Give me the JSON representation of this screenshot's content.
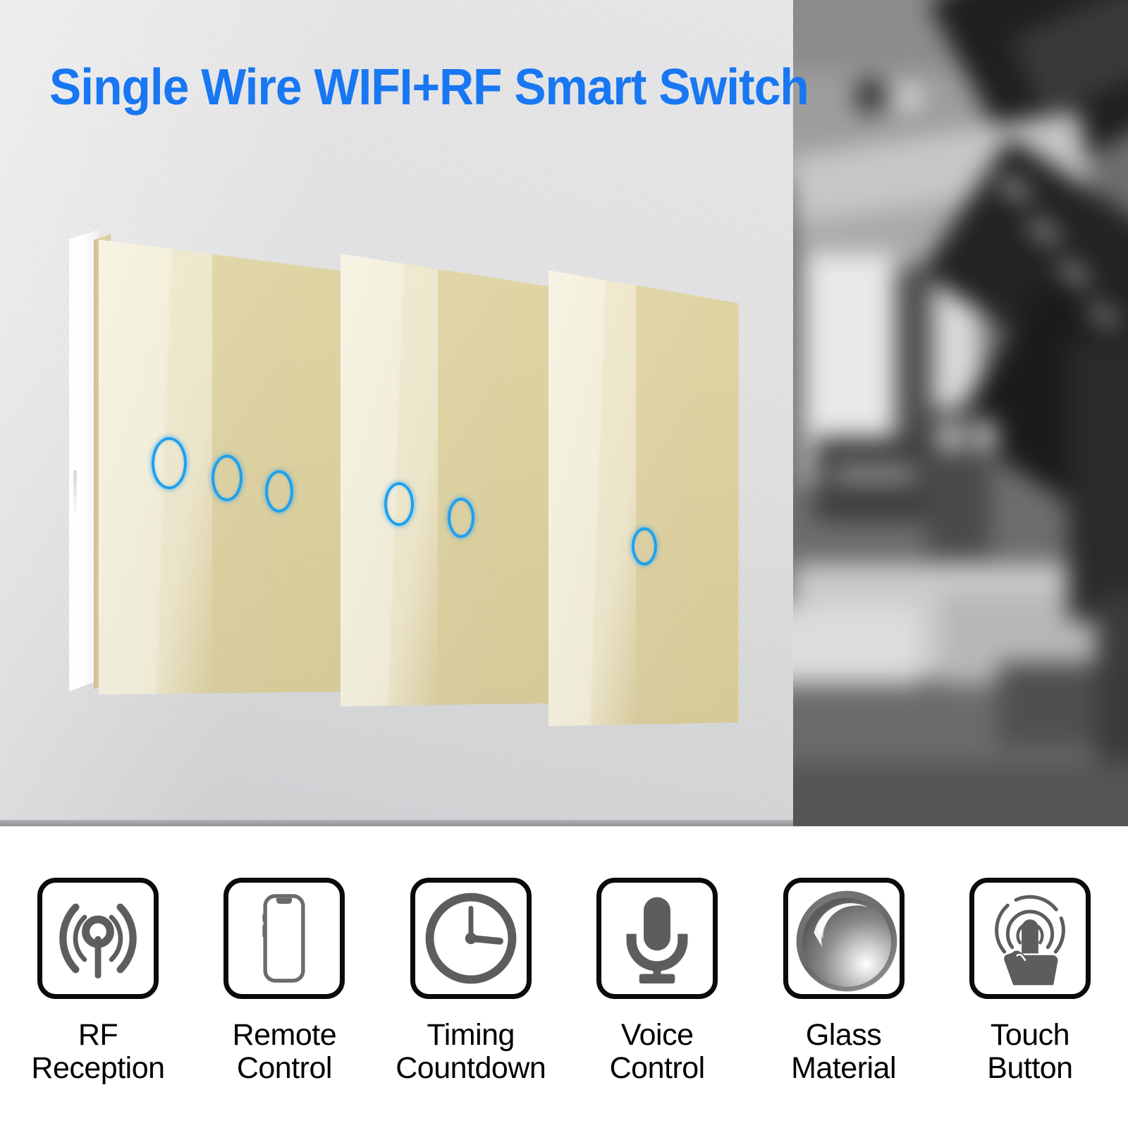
{
  "hero": {
    "title": "Single Wire WIFI+RF Smart Switch",
    "title_color": "#1877f2",
    "product": {
      "name": "gold-glass-touch-switch",
      "panels": [
        {
          "id": "panel-3-gang",
          "gang": 3,
          "touch_ovals": 3
        },
        {
          "id": "panel-2-gang",
          "gang": 2,
          "touch_ovals": 2
        },
        {
          "id": "panel-1-gang",
          "gang": 1,
          "touch_ovals": 1
        }
      ],
      "glass_color": "#ddd09c",
      "indicator_color": "#1ea0ee",
      "backplate_color": "#ffffff"
    },
    "scene": {
      "left": "textured-light-grey-wall",
      "right": "blurred-greyscale-interior-hallway"
    }
  },
  "features": [
    {
      "icon": "rf-antenna-icon",
      "label": "RF\nReception"
    },
    {
      "icon": "smartphone-icon",
      "label": "Remote\nControl"
    },
    {
      "icon": "clock-icon",
      "label": "Timing\nCountdown"
    },
    {
      "icon": "microphone-icon",
      "label": "Voice\nControl"
    },
    {
      "icon": "glass-sphere-icon",
      "label": "Glass\nMaterial"
    },
    {
      "icon": "touch-finger-icon",
      "label": "Touch\nButton"
    }
  ],
  "colors": {
    "accent_blue": "#1877f2",
    "indicator_blue": "#1ea0ee",
    "icon_grey": "#5d5d5d",
    "icon_border": "#0a0a0a",
    "glass_gold": "#ddd09c"
  }
}
